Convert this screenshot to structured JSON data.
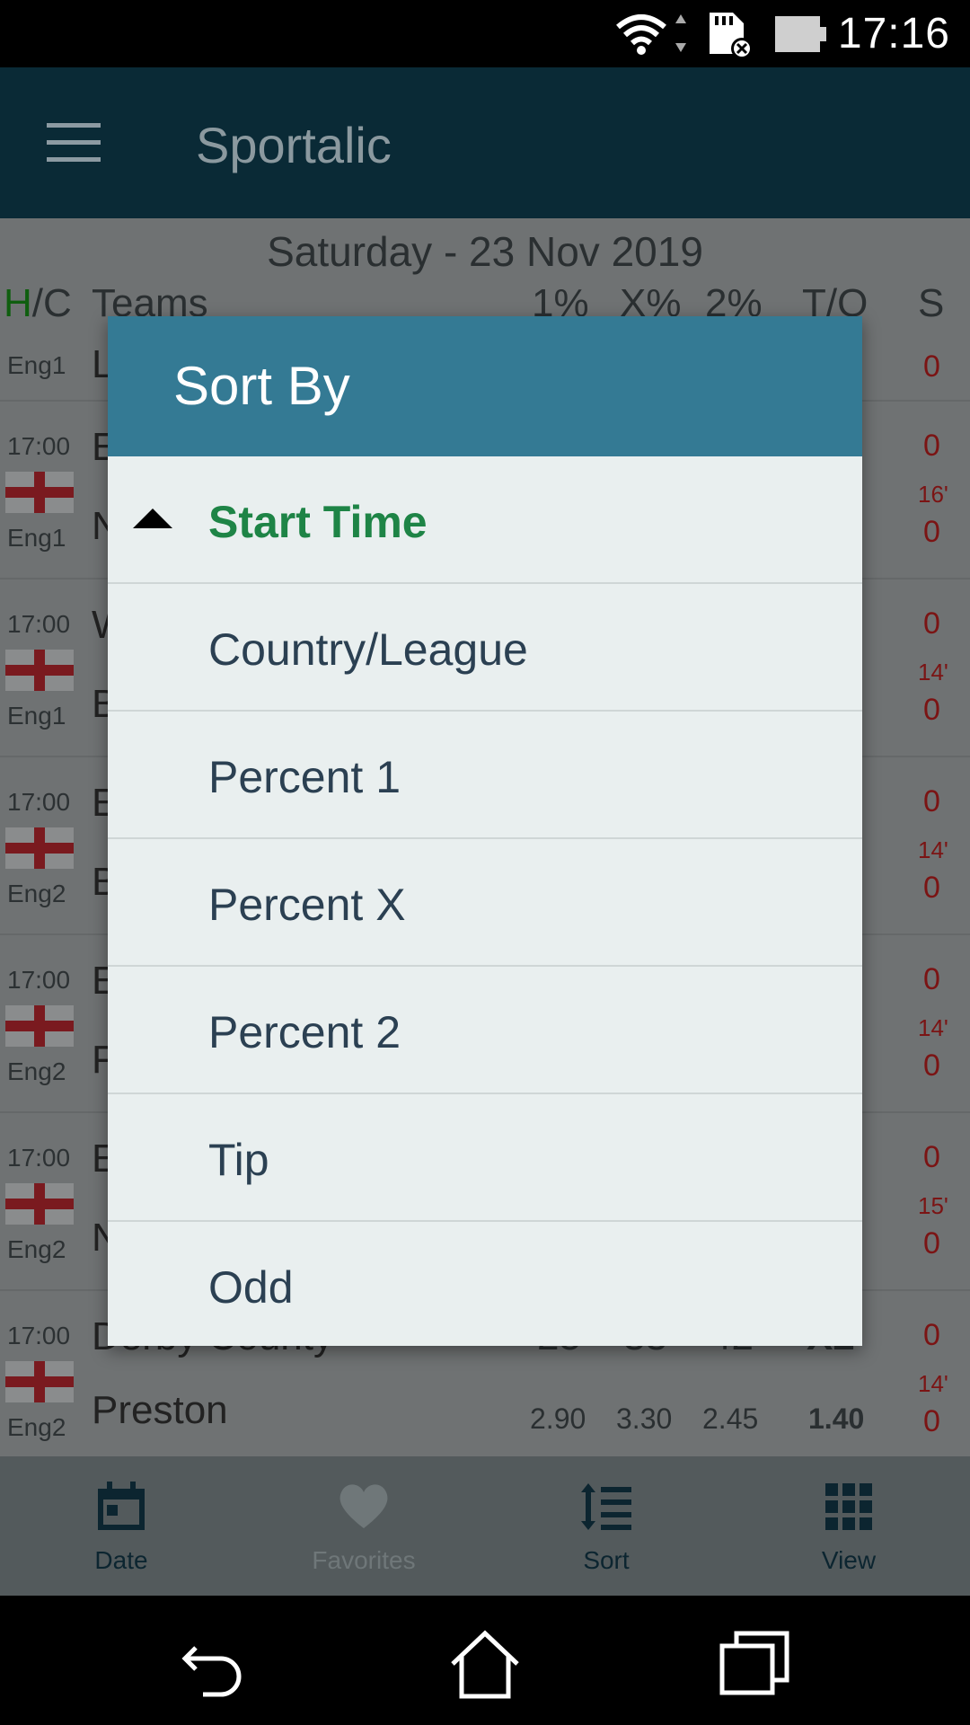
{
  "status_bar": {
    "time": "17:16",
    "icons": [
      "wifi-icon",
      "sd-card-icon",
      "battery-icon"
    ]
  },
  "app_bar": {
    "title": "Sportalic",
    "menu_icon": "hamburger-menu-icon"
  },
  "content": {
    "date": "Saturday - 23 Nov 2019",
    "columns": {
      "hc_h": "H",
      "hc_c": "/C",
      "teams": "Teams",
      "p1": "1%",
      "px": "X%",
      "p2": "2%",
      "to": "T/O",
      "s": "S"
    },
    "rows": [
      {
        "league": "Eng1",
        "team_top": "L",
        "team_bottom": "",
        "time": "",
        "score_top": "0",
        "score_bottom": "",
        "minute": ""
      },
      {
        "time": "17:00",
        "league": "Eng1",
        "team_top": "E",
        "team_bottom": "N",
        "score_top": "0",
        "minute": "16'",
        "score_bottom": "0"
      },
      {
        "time": "17:00",
        "league": "Eng1",
        "team_top": "W",
        "team_bottom": "B",
        "score_top": "0",
        "minute": "14'",
        "score_bottom": "0"
      },
      {
        "time": "17:00",
        "league": "Eng2",
        "team_top": "E",
        "team_bottom": "B",
        "score_top": "0",
        "minute": "14'",
        "score_bottom": "0"
      },
      {
        "time": "17:00",
        "league": "Eng2",
        "team_top": "E",
        "team_bottom": "F",
        "score_top": "0",
        "minute": "14'",
        "score_bottom": "0"
      },
      {
        "time": "17:00",
        "league": "Eng2",
        "team_top": "E",
        "team_bottom": "N",
        "score_top": "0",
        "minute": "15'",
        "score_bottom": "0"
      },
      {
        "time": "17:00",
        "league": "Eng2",
        "team_top": "Derby County",
        "team_bottom": "Preston",
        "p1": "25",
        "px": "33",
        "p2": "42",
        "tip": "X2",
        "odd1": "2.90",
        "oddx": "3.30",
        "odd2": "2.45",
        "odd_tip": "1.40",
        "score_top": "0",
        "minute": "14'",
        "score_bottom": "0"
      }
    ]
  },
  "bottom_nav": [
    {
      "label": "Date",
      "icon": "calendar-icon"
    },
    {
      "label": "Favorites",
      "icon": "heart-icon"
    },
    {
      "label": "Sort",
      "icon": "sort-icon"
    },
    {
      "label": "View",
      "icon": "grid-icon"
    }
  ],
  "system_nav": [
    "back-icon",
    "home-icon",
    "recents-icon"
  ],
  "dialog": {
    "title": "Sort By",
    "options": [
      {
        "label": "Start Time",
        "selected": true
      },
      {
        "label": "Country/League",
        "selected": false
      },
      {
        "label": "Percent 1",
        "selected": false
      },
      {
        "label": "Percent X",
        "selected": false
      },
      {
        "label": "Percent 2",
        "selected": false
      },
      {
        "label": "Tip",
        "selected": false
      },
      {
        "label": "Odd",
        "selected": false
      }
    ]
  },
  "colors": {
    "appbar": "#0a2a36",
    "dialog_header": "#347a94",
    "selected_option": "#1e8446",
    "score": "#7b1414"
  }
}
